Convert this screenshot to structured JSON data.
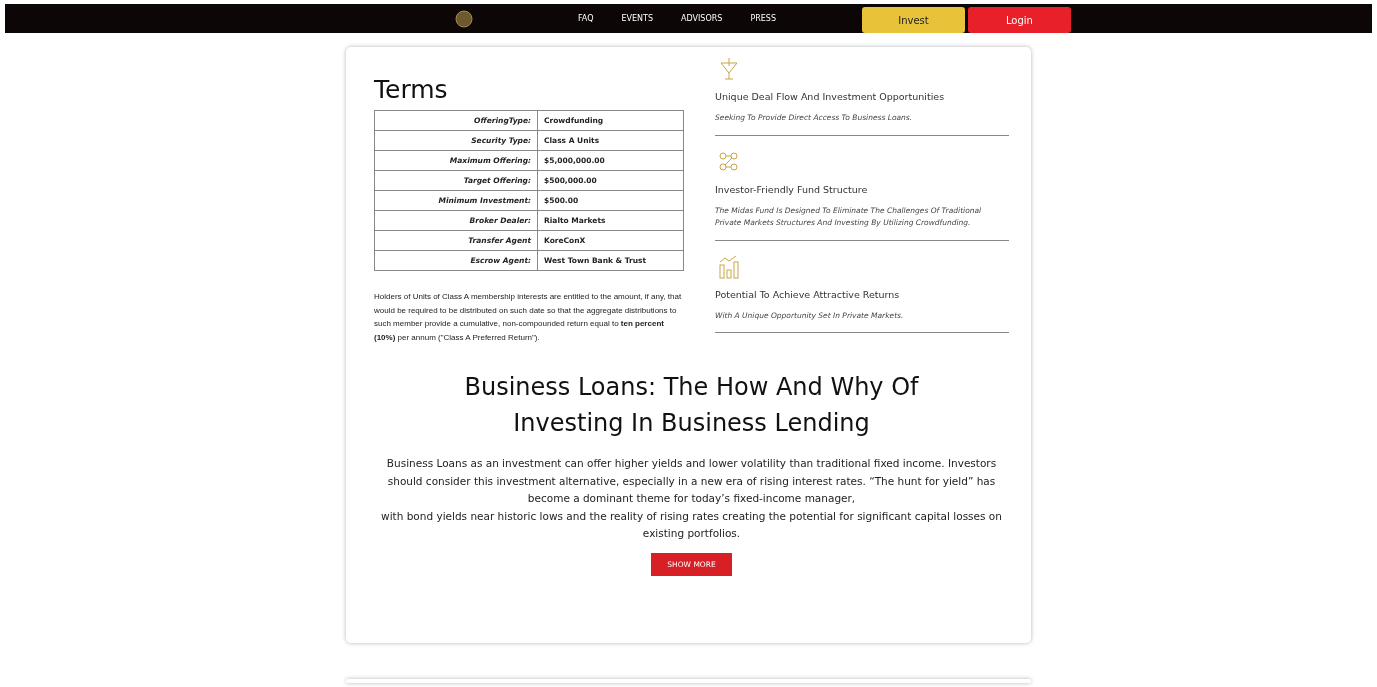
{
  "nav": {
    "links": [
      "FAQ",
      "EVENTS",
      "ADVISORS",
      "PRESS"
    ],
    "invest": "Invest",
    "login": "Login"
  },
  "terms": {
    "title": "Terms",
    "rows": [
      {
        "label": "OfferingType:",
        "value": "Crowdfunding"
      },
      {
        "label": "Security Type:",
        "value": "Class A Units"
      },
      {
        "label": "Maximum Offering:",
        "value": "$5,000,000.00"
      },
      {
        "label": "Target Offering:",
        "value": "$500,000.00"
      },
      {
        "label": "Minimum Investment:",
        "value": "$500.00"
      },
      {
        "label": "Broker Dealer:",
        "value": "Rialto Markets"
      },
      {
        "label": "Transfer Agent",
        "value": "KoreConX"
      },
      {
        "label": "Escrow Agent:",
        "value": "West Town Bank & Trust"
      }
    ],
    "note": "Holders of Units of Class A membership interests are entitled to the amount, if any, that would be required to be distributed on such date so that the aggregate distributions to such member provide a cumulative, non-compounded return equal to **ten percent (10%)** per annum (\"Class A Preferred Return\")."
  },
  "features": [
    {
      "kind": "trophy",
      "title": "Unique Deal Flow And Investment Opportunities",
      "text": "Seeking To Provide Direct Access To Business Loans."
    },
    {
      "kind": "nodes",
      "title": "Investor-Friendly Fund Structure",
      "text": "The Midas Fund Is Designed To Eliminate The Challenges Of Traditional Private Markets Structures And Investing By Utilizing Crowdfunding."
    },
    {
      "kind": "chart",
      "title": "Potential To Achieve Attractive Returns",
      "text": "With A Unique Opportunity Set In Private Markets."
    }
  ],
  "article": {
    "heading": "Business Loans: The How And Why Of Investing In Business Lending",
    "lines": [
      "Business Loans as an investment can offer higher yields and lower volatility than traditional fixed income. Investors should consider this investment alternative, especially in a new era of rising interest rates. “The hunt for yield” has become a dominant theme for today’s fixed-income manager,",
      "with bond yields near historic lows and the reality of rising rates creating the potential for significant capital losses on existing portfolios."
    ],
    "button": "SHOW MORE"
  }
}
